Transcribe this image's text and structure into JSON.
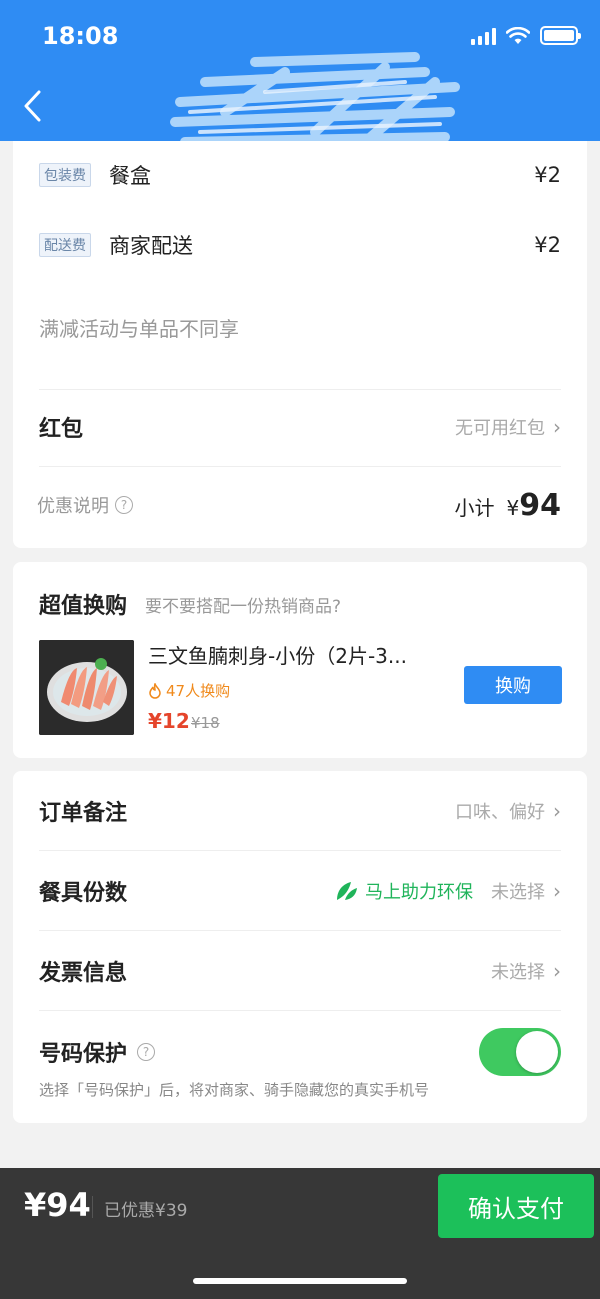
{
  "status_bar": {
    "time": "18:08"
  },
  "colors": {
    "primary": "#2f8cf3",
    "price_red": "#e5452b",
    "green": "#1cc05a",
    "orange": "#f08a1c"
  },
  "fees": [
    {
      "tag": "包装费",
      "name": "餐盒",
      "price": "¥2"
    },
    {
      "tag": "配送费",
      "name": "商家配送",
      "price": "¥2"
    }
  ],
  "promo_note": "满减活动与单品不同享",
  "hongbao": {
    "title": "红包",
    "value": "无可用红包"
  },
  "subtotal": {
    "info_label": "优惠说明",
    "label": "小计",
    "currency": "¥",
    "amount": "94"
  },
  "swap": {
    "title": "超值换购",
    "subtitle": "要不要搭配一份热销商品?",
    "product_name": "三文鱼腩刺身-小份（2片-3...",
    "hot": "47人换购",
    "price": "¥12",
    "original_price": "¥18",
    "button": "换购"
  },
  "options": {
    "remark": {
      "title": "订单备注",
      "value": "口味、偏好"
    },
    "tableware": {
      "title": "餐具份数",
      "eco": "马上助力环保",
      "value": "未选择"
    },
    "invoice": {
      "title": "发票信息",
      "value": "未选择"
    },
    "phone": {
      "title": "号码保护",
      "enabled": true,
      "note": "选择「号码保护」后，将对商家、骑手隐藏您的真实手机号"
    }
  },
  "footer": {
    "total": "¥94",
    "saved": "已优惠¥39",
    "pay_button": "确认支付"
  }
}
